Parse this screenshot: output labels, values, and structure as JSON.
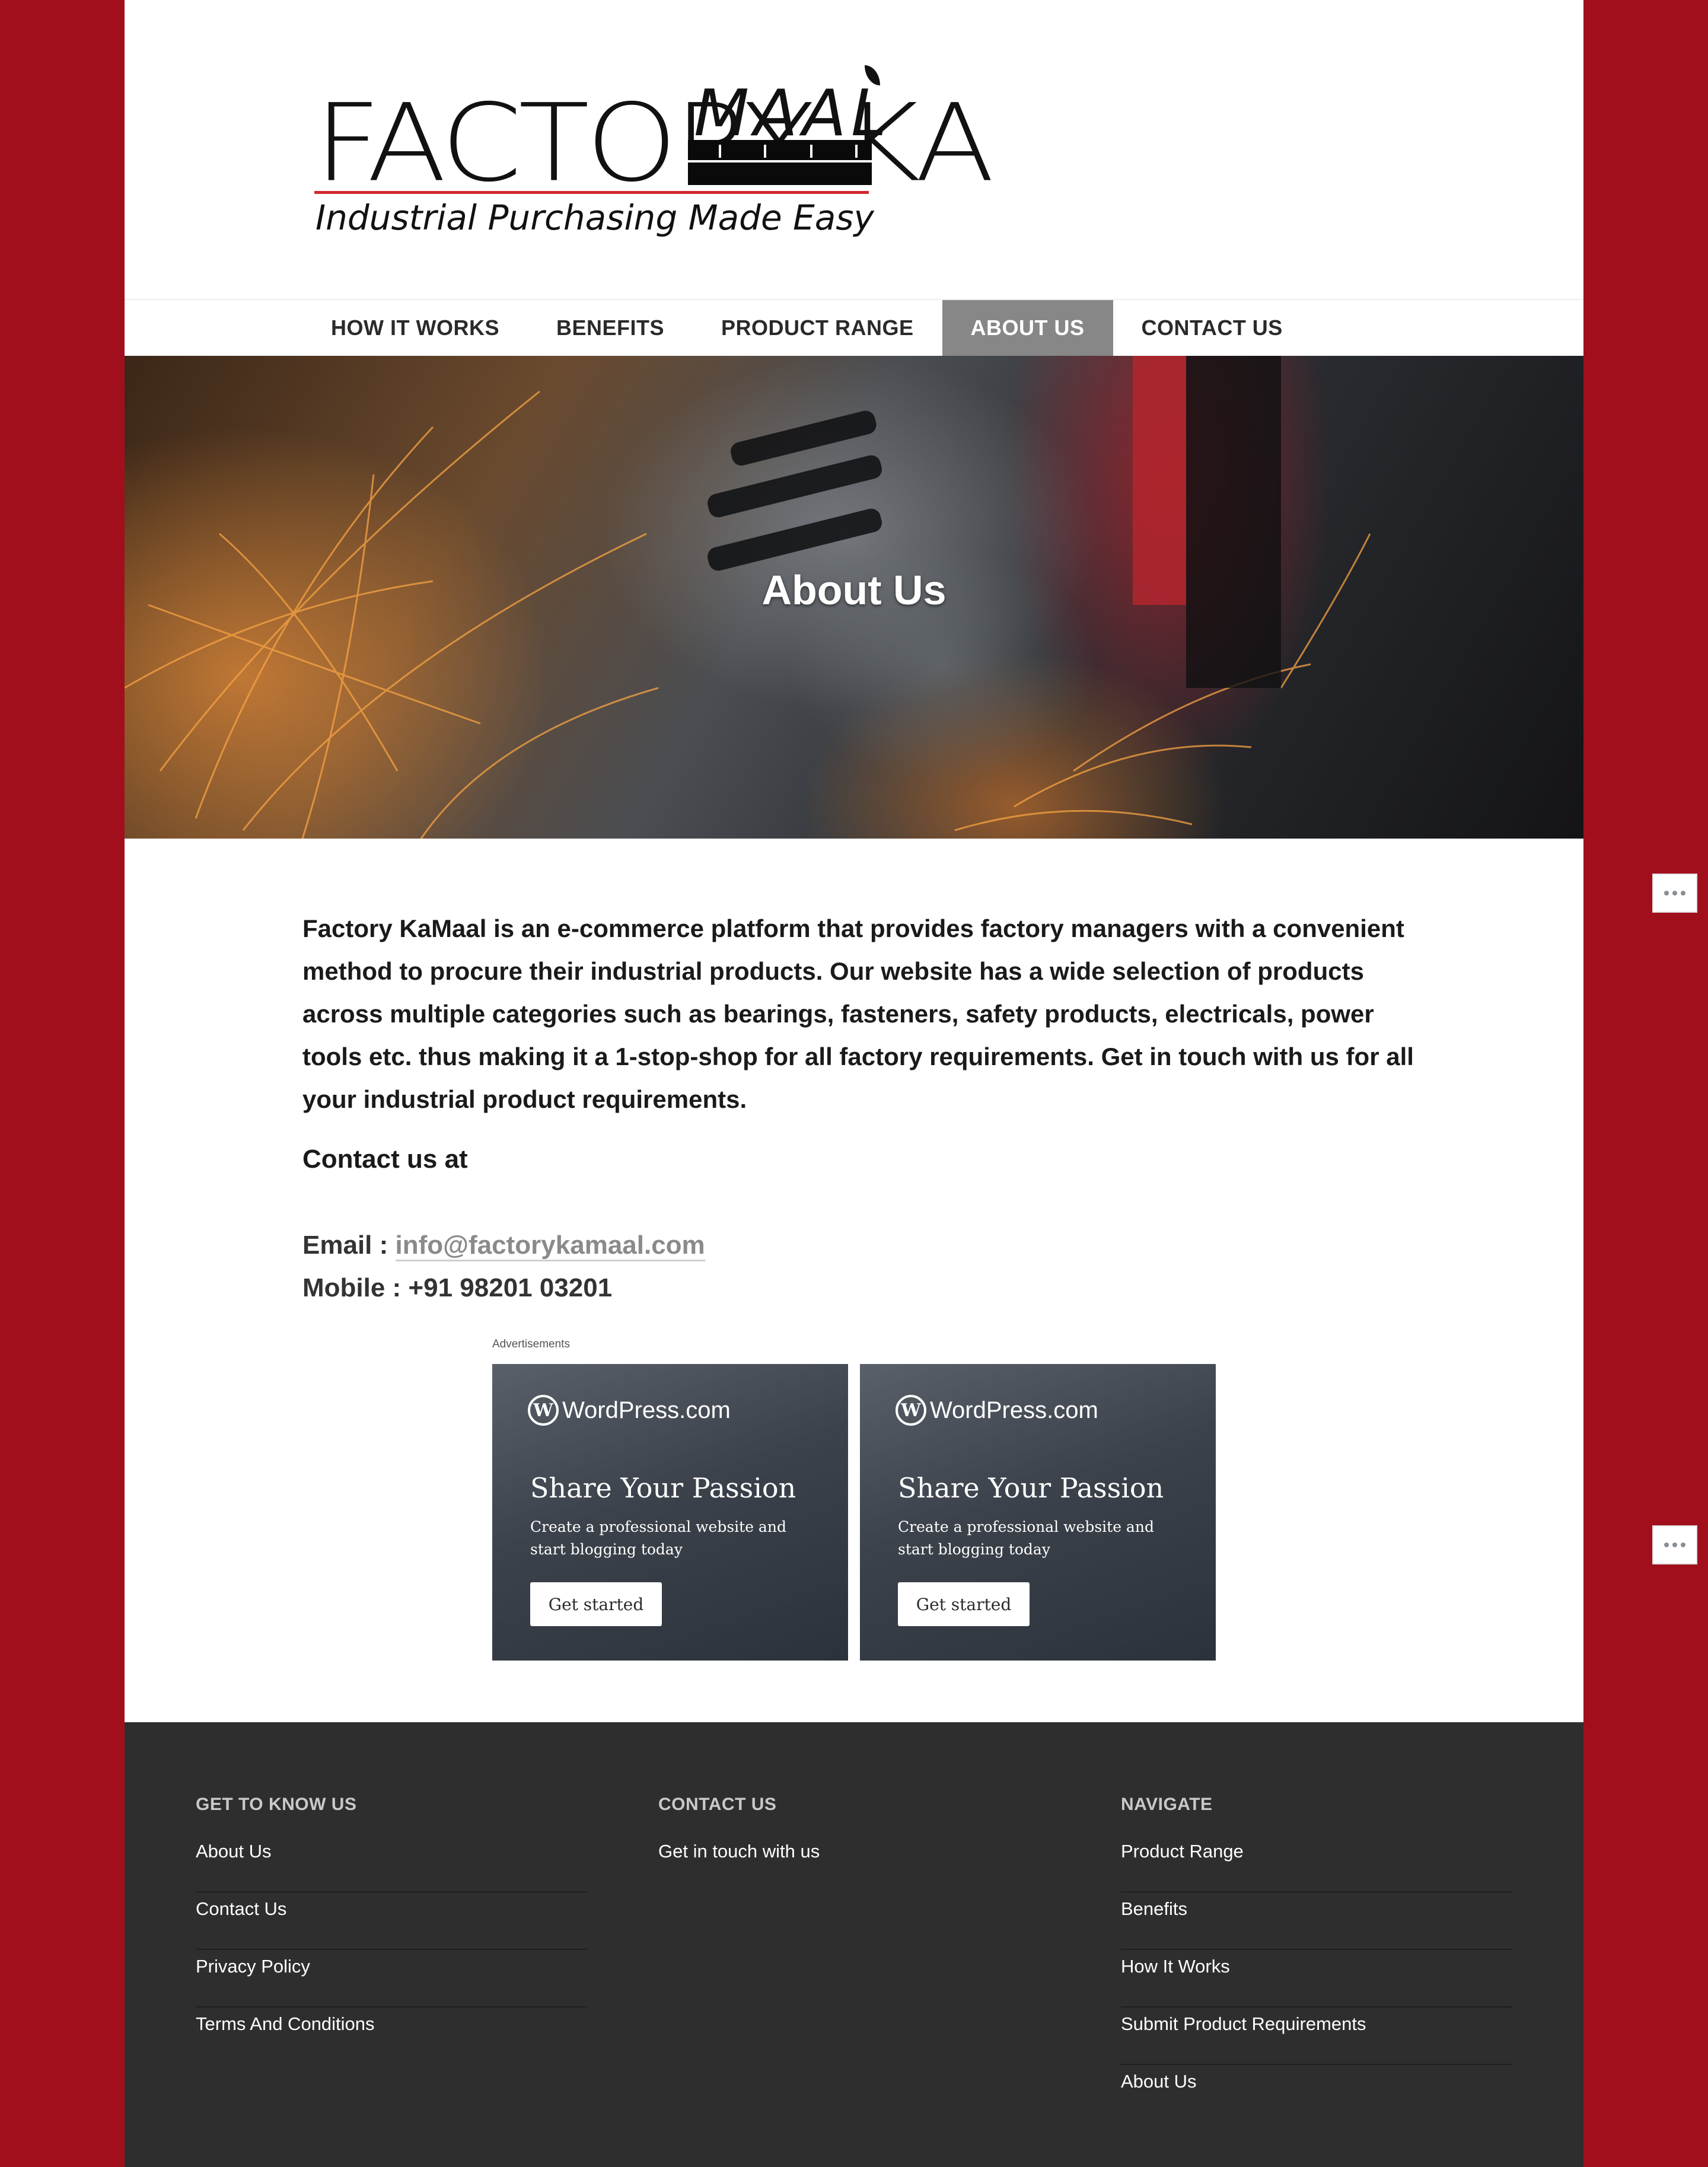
{
  "brand": {
    "logo_name_left": "FACTORY KA",
    "logo_name_right": "MAAL",
    "tagline": "Industrial Purchasing Made Easy",
    "accent_color": "#a10f1d"
  },
  "nav": {
    "items": [
      {
        "label": "HOW IT WORKS"
      },
      {
        "label": "BENEFITS"
      },
      {
        "label": "PRODUCT RANGE"
      },
      {
        "label": "ABOUT US",
        "active": true
      },
      {
        "label": "CONTACT US"
      }
    ]
  },
  "hero": {
    "title": "About Us"
  },
  "content": {
    "intro": "Factory KaMaal is an e-commerce platform that provides factory managers with a convenient method to procure their industrial products. Our website has a wide selection of products across multiple categories such as bearings, fasteners, safety products, electricals, power tools etc. thus making it a 1-stop-shop for all factory requirements. Get in touch with us for all your industrial product requirements.",
    "contact_heading": "Contact us at",
    "email_label": "Email : ",
    "email_value": "info@factorykamaal.com",
    "mobile_label": "Mobile : +91 98201 03201"
  },
  "ads": {
    "label": "Advertisements",
    "items": [
      {
        "brand": "WordPress.com",
        "headline": "Share Your Passion",
        "sub": "Create a professional website and start blogging today",
        "button": "Get started"
      },
      {
        "brand": "WordPress.com",
        "headline": "Share Your Passion",
        "sub": "Create a professional website and start blogging today",
        "button": "Get started"
      }
    ]
  },
  "footer": {
    "col1": {
      "title": "GET TO KNOW US",
      "links": [
        "About Us",
        "Contact Us",
        "Privacy Policy",
        "Terms And Conditions"
      ]
    },
    "col2": {
      "title": "CONTACT US",
      "links": [
        "Get in touch with us"
      ]
    },
    "col3": {
      "title": "NAVIGATE",
      "links": [
        "Product Range",
        "Benefits",
        "How It Works",
        "Submit Product Requirements",
        "About Us"
      ]
    }
  },
  "side_buttons": {
    "icon": "more-horizontal-icon"
  }
}
